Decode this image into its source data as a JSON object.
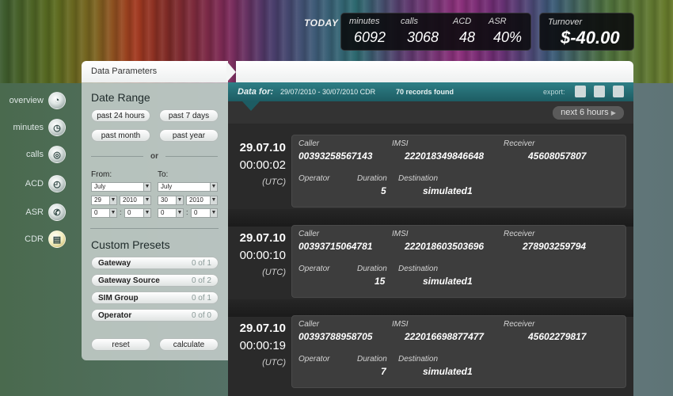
{
  "stats": {
    "today_label": "TODAY",
    "minutes": {
      "label": "minutes",
      "value": "6092"
    },
    "calls": {
      "label": "calls",
      "value": "3068"
    },
    "acd": {
      "label": "ACD",
      "value": "48"
    },
    "asr": {
      "label": "ASR",
      "value": "40%"
    },
    "turnover": {
      "label": "Turnover",
      "value": "$-40.00"
    }
  },
  "nav": [
    {
      "label": "overview",
      "icon": "gauge-icon"
    },
    {
      "label": "minutes",
      "icon": "clock-icon"
    },
    {
      "label": "calls",
      "icon": "signal-icon"
    },
    {
      "label": "ACD",
      "icon": "timer-icon"
    },
    {
      "label": "ASR",
      "icon": "phone-icon"
    },
    {
      "label": "CDR",
      "icon": "document-icon"
    }
  ],
  "panel": {
    "title": "Data Parameters",
    "date_range_title": "Date Range",
    "quick": [
      "past 24 hours",
      "past 7 days",
      "past month",
      "past year"
    ],
    "or": "or",
    "from_label": "From:",
    "to_label": "To:",
    "from": {
      "month": "July",
      "day": "29",
      "year": "2010",
      "hour": "0",
      "minute": "0"
    },
    "to": {
      "month": "July",
      "day": "30",
      "year": "2010",
      "hour": "0",
      "minute": "0"
    },
    "presets_title": "Custom Presets",
    "presets": [
      {
        "name": "Gateway",
        "count": "0 of 1"
      },
      {
        "name": "Gateway Source",
        "count": "0 of 2"
      },
      {
        "name": "SIM Group",
        "count": "0 of 1"
      },
      {
        "name": "Operator",
        "count": "0 of 0"
      }
    ],
    "reset": "reset",
    "calculate": "calculate"
  },
  "databar": {
    "data_for": "Data for:",
    "range": "29/07/2010 - 30/07/2010 CDR",
    "records": "70 records found",
    "export": "export:",
    "next": "next 6 hours"
  },
  "labels": {
    "caller": "Caller",
    "imsi": "IMSI",
    "receiver": "Receiver",
    "operator": "Operator",
    "duration": "Duration",
    "destination": "Destination",
    "tz": "(UTC)"
  },
  "records": [
    {
      "date": "29.07.10",
      "time": "00:00:02",
      "caller": "00393258567143",
      "imsi": "222018349846648",
      "receiver": "45608057807",
      "duration": "5",
      "destination": "simulated1"
    },
    {
      "date": "29.07.10",
      "time": "00:00:10",
      "caller": "00393715064781",
      "imsi": "222018603503696",
      "receiver": "278903259794",
      "duration": "15",
      "destination": "simulated1"
    },
    {
      "date": "29.07.10",
      "time": "00:00:19",
      "caller": "00393788958705",
      "imsi": "222016698877477",
      "receiver": "45602279817",
      "duration": "7",
      "destination": "simulated1"
    }
  ]
}
